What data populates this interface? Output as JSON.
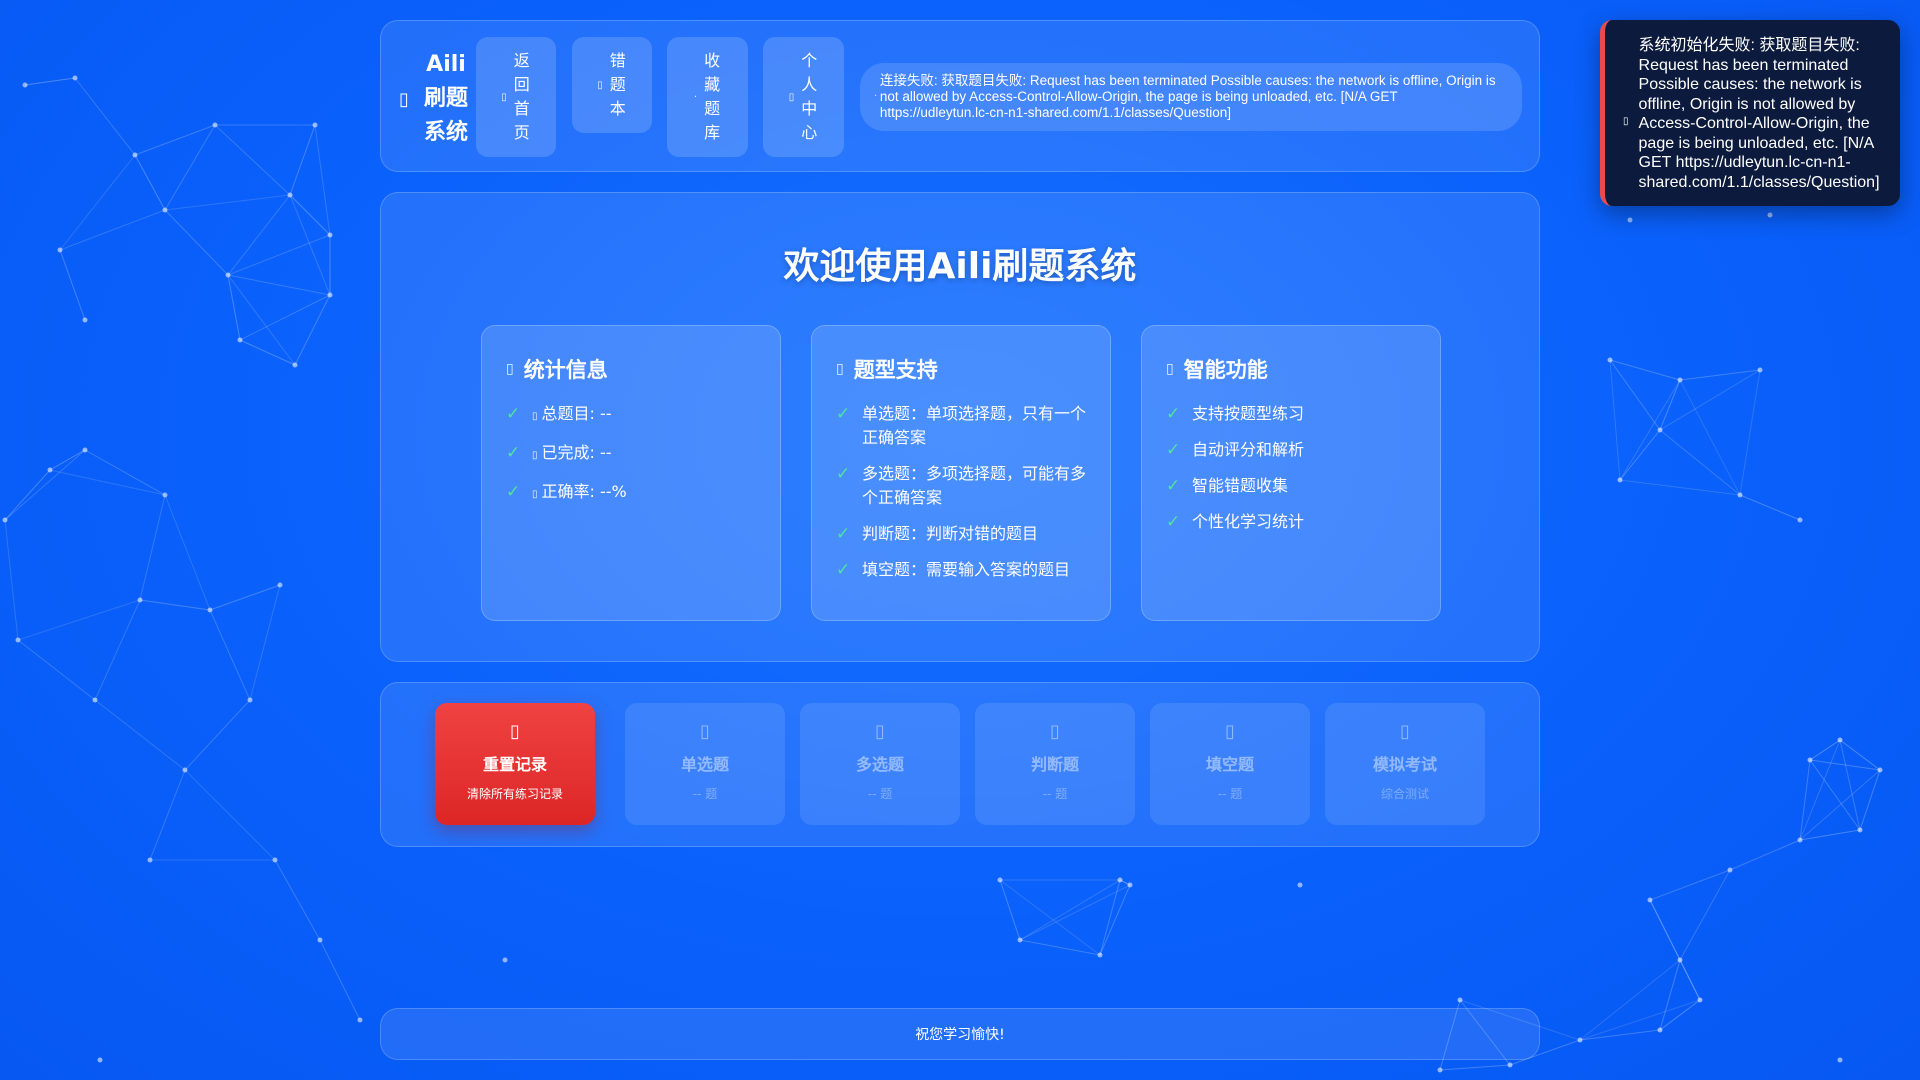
{
  "header": {
    "brand_title": "Aili刷题系统",
    "brand_icon": "book-icon",
    "nav": [
      {
        "label": "返回首页",
        "icon": "home-icon"
      },
      {
        "label": "错题本",
        "icon": "warning-icon"
      },
      {
        "label": "收藏题库",
        "icon": "star-icon"
      },
      {
        "label": "个人中心",
        "icon": "user-icon"
      }
    ],
    "status_text": "连接失败: 获取题目失败: Request has been terminated Possible causes: the network is offline, Origin is not allowed by Access-Control-Allow-Origin, the page is being unloaded, etc. [N/A GET https://udleytun.lc-cn-n1-shared.com/1.1/classes/Question]"
  },
  "welcome": {
    "title": "欢迎使用Aili刷题系统",
    "cards": [
      {
        "title": "统计信息",
        "items": [
          "总题目: --",
          "已完成: --",
          "正确率: --%"
        ]
      },
      {
        "title": "题型支持",
        "items": [
          "单选题：单项选择题，只有一个正确答案",
          "多选题：多项选择题，可能有多个正确答案",
          "判断题：判断对错的题目",
          "填空题：需要输入答案的题目"
        ]
      },
      {
        "title": "智能功能",
        "items": [
          "支持按题型练习",
          "自动评分和解析",
          "智能错题收集",
          "个性化学习统计"
        ]
      }
    ]
  },
  "actions": [
    {
      "label": "重置记录",
      "sub": "清除所有练习记录",
      "icon": "trash-icon",
      "color": "#dc2626"
    },
    {
      "label": "单选题",
      "sub": "-- 题",
      "icon": "circle-dot-icon"
    },
    {
      "label": "多选题",
      "sub": "-- 题",
      "icon": "checkbox-icon"
    },
    {
      "label": "判断题",
      "sub": "-- 题",
      "icon": "check-circle-icon"
    },
    {
      "label": "填空题",
      "sub": "-- 题",
      "icon": "pencil-icon"
    },
    {
      "label": "模拟考试",
      "sub": "综合测试",
      "icon": "clipboard-icon"
    }
  ],
  "footer": {
    "text": "祝您学习愉快!"
  },
  "toast": {
    "text": "系统初始化失败: 获取题目失败: Request has been terminated Possible causes: the network is offline, Origin is not allowed by Access-Control-Allow-Origin, the page is being unloaded, etc. [N/A GET https://udleytun.lc-cn-n1-shared.com/1.1/classes/Question]",
    "accent": "#e74c4c"
  },
  "colors": {
    "background": "#0a63ff",
    "check": "#4ee39b",
    "toast_bg": "#0c1b3d"
  }
}
